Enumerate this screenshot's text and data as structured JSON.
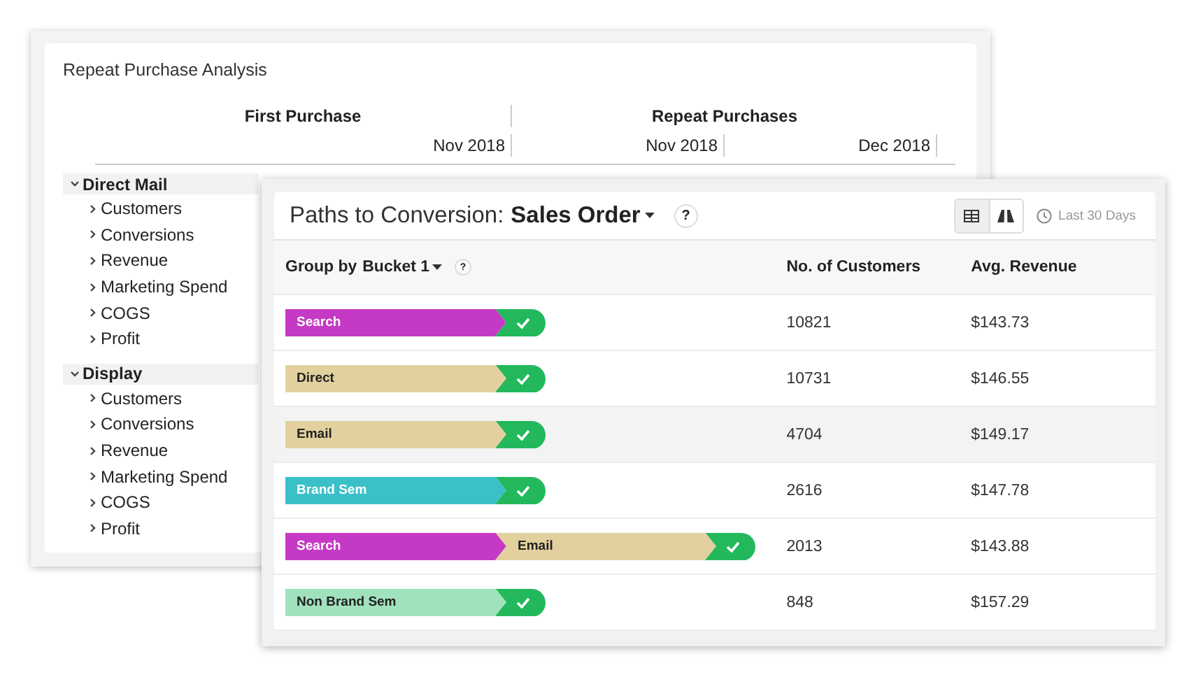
{
  "report": {
    "title": "Repeat Purchase Analysis",
    "column_groups": [
      {
        "label": "First Purchase",
        "months": [
          "Nov 2018"
        ]
      },
      {
        "label": "Repeat Purchases",
        "months": [
          "Nov 2018",
          "Dec 2018"
        ]
      }
    ],
    "tree": [
      {
        "label": "Direct Mail",
        "expanded": true,
        "children": [
          {
            "label": "Customers",
            "expanded": false
          },
          {
            "label": "Conversions",
            "expanded": false
          },
          {
            "label": "Revenue",
            "expanded": false
          },
          {
            "label": "Marketing Spend",
            "expanded": false
          },
          {
            "label": "COGS",
            "expanded": false
          },
          {
            "label": "Profit",
            "expanded": false
          }
        ]
      },
      {
        "label": "Display",
        "expanded": true,
        "children": [
          {
            "label": "Customers",
            "expanded": false
          },
          {
            "label": "Conversions",
            "expanded": false
          },
          {
            "label": "Revenue",
            "expanded": false
          },
          {
            "label": "Marketing Spend",
            "expanded": false
          },
          {
            "label": "COGS",
            "expanded": false
          },
          {
            "label": "Profit",
            "expanded": false
          }
        ]
      }
    ]
  },
  "paths": {
    "title": "Paths to Conversion:",
    "object": "Sales Order",
    "help": "?",
    "views": [
      {
        "kind": "table",
        "selected": true
      },
      {
        "kind": "funnel",
        "selected": false
      }
    ],
    "range": "Last 30 Days",
    "group_by": "Group by",
    "bucket": "Bucket 1",
    "group_help": "?",
    "columns": [
      "No. of Customers",
      "Avg. Revenue"
    ],
    "rows": [
      {
        "steps": [
          {
            "label": "Search",
            "color": "#c53ac4"
          }
        ],
        "customers": "10821",
        "revenue": "$143.73",
        "selected": false
      },
      {
        "steps": [
          {
            "label": "Direct",
            "color": "#e2d09e"
          }
        ],
        "customers": "10731",
        "revenue": "$146.55",
        "selected": false
      },
      {
        "steps": [
          {
            "label": "Email",
            "color": "#e2d09e"
          }
        ],
        "customers": "4704",
        "revenue": "$149.17",
        "selected": true
      },
      {
        "steps": [
          {
            "label": "Brand Sem",
            "color": "#3bc0c8"
          }
        ],
        "customers": "2616",
        "revenue": "$147.78",
        "selected": false
      },
      {
        "steps": [
          {
            "label": "Search",
            "color": "#c53ac4"
          },
          {
            "label": "Email",
            "color": "#e2d09e"
          }
        ],
        "customers": "2013",
        "revenue": "$143.88",
        "selected": false
      },
      {
        "steps": [
          {
            "label": "Non Brand Sem",
            "color": "#a0e2bc"
          }
        ],
        "customers": "848",
        "revenue": "$157.29",
        "selected": false
      }
    ]
  }
}
